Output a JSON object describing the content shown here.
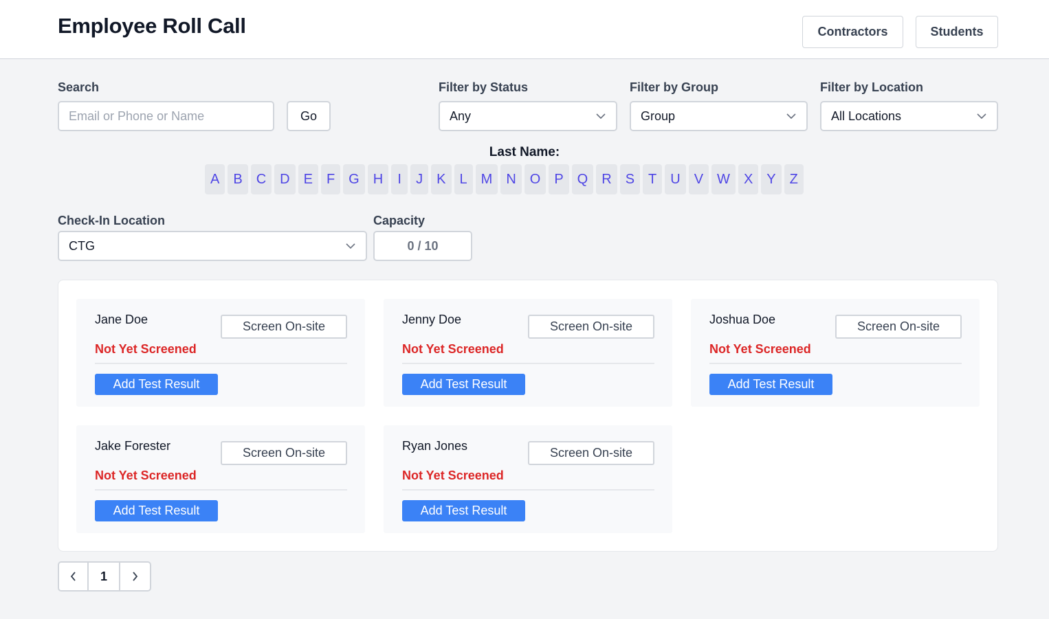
{
  "header": {
    "title": "Employee Roll Call",
    "buttons": [
      "Contractors",
      "Students"
    ]
  },
  "search": {
    "label": "Search",
    "placeholder": "Email or Phone or Name",
    "value": "",
    "go_label": "Go"
  },
  "filters": {
    "status": {
      "label": "Filter by Status",
      "value": "Any"
    },
    "group": {
      "label": "Filter by Group",
      "value": "Group"
    },
    "location": {
      "label": "Filter by Location",
      "value": "All Locations"
    }
  },
  "last_name": {
    "label": "Last Name:",
    "letters": [
      "A",
      "B",
      "C",
      "D",
      "E",
      "F",
      "G",
      "H",
      "I",
      "J",
      "K",
      "L",
      "M",
      "N",
      "O",
      "P",
      "Q",
      "R",
      "S",
      "T",
      "U",
      "V",
      "W",
      "X",
      "Y",
      "Z"
    ]
  },
  "checkin": {
    "label": "Check-In Location",
    "value": "CTG"
  },
  "capacity": {
    "label": "Capacity",
    "value": "0 / 10"
  },
  "employees": [
    {
      "name": "Jane Doe",
      "screen_label": "Screen On-site",
      "status": "Not Yet Screened",
      "action_label": "Add Test Result"
    },
    {
      "name": "Jenny Doe",
      "screen_label": "Screen On-site",
      "status": "Not Yet Screened",
      "action_label": "Add Test Result"
    },
    {
      "name": "Joshua Doe",
      "screen_label": "Screen On-site",
      "status": "Not Yet Screened",
      "action_label": "Add Test Result"
    },
    {
      "name": "Jake Forester",
      "screen_label": "Screen On-site",
      "status": "Not Yet Screened",
      "action_label": "Add Test Result"
    },
    {
      "name": "Ryan Jones",
      "screen_label": "Screen On-site",
      "status": "Not Yet Screened",
      "action_label": "Add Test Result"
    }
  ],
  "pagination": {
    "current_page": "1",
    "prev_icon": "chevron-left-icon",
    "next_icon": "chevron-right-icon"
  },
  "colors": {
    "accent": "#3b82f6",
    "status_red": "#dc2626",
    "letter_link": "#4f46e5"
  }
}
